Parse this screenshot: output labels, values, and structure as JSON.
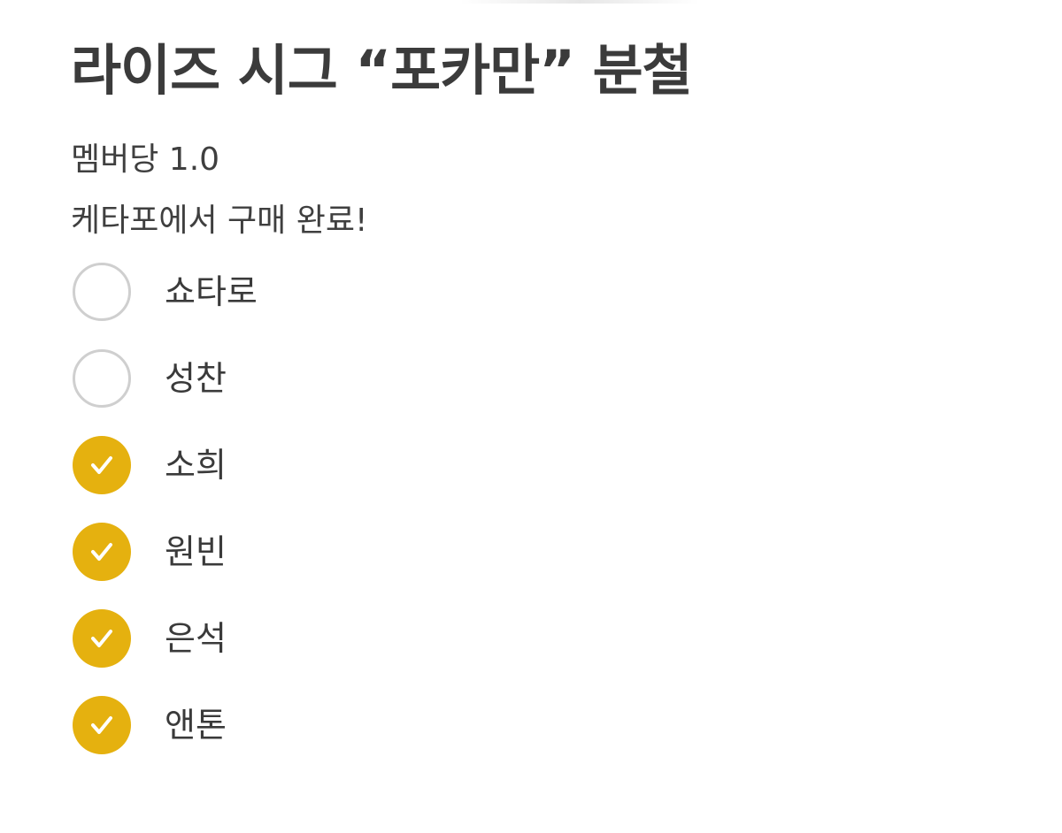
{
  "post": {
    "title": "라이즈 시그 “포카만” 분철",
    "subtitle": "멤버당 1.0",
    "note": "케타포에서 구매 완료!"
  },
  "members": [
    {
      "name": "쇼타로",
      "checked": false
    },
    {
      "name": "성찬",
      "checked": false
    },
    {
      "name": "소희",
      "checked": true
    },
    {
      "name": "원빈",
      "checked": true
    },
    {
      "name": "은석",
      "checked": true
    },
    {
      "name": "앤톤",
      "checked": true
    }
  ],
  "colors": {
    "check_fill": "#e5b10f",
    "unchecked_border": "#cfcfcf",
    "text": "#3a3a3a"
  },
  "icons": {
    "checked": "checkmark-icon",
    "unchecked": "empty-circle-icon"
  }
}
